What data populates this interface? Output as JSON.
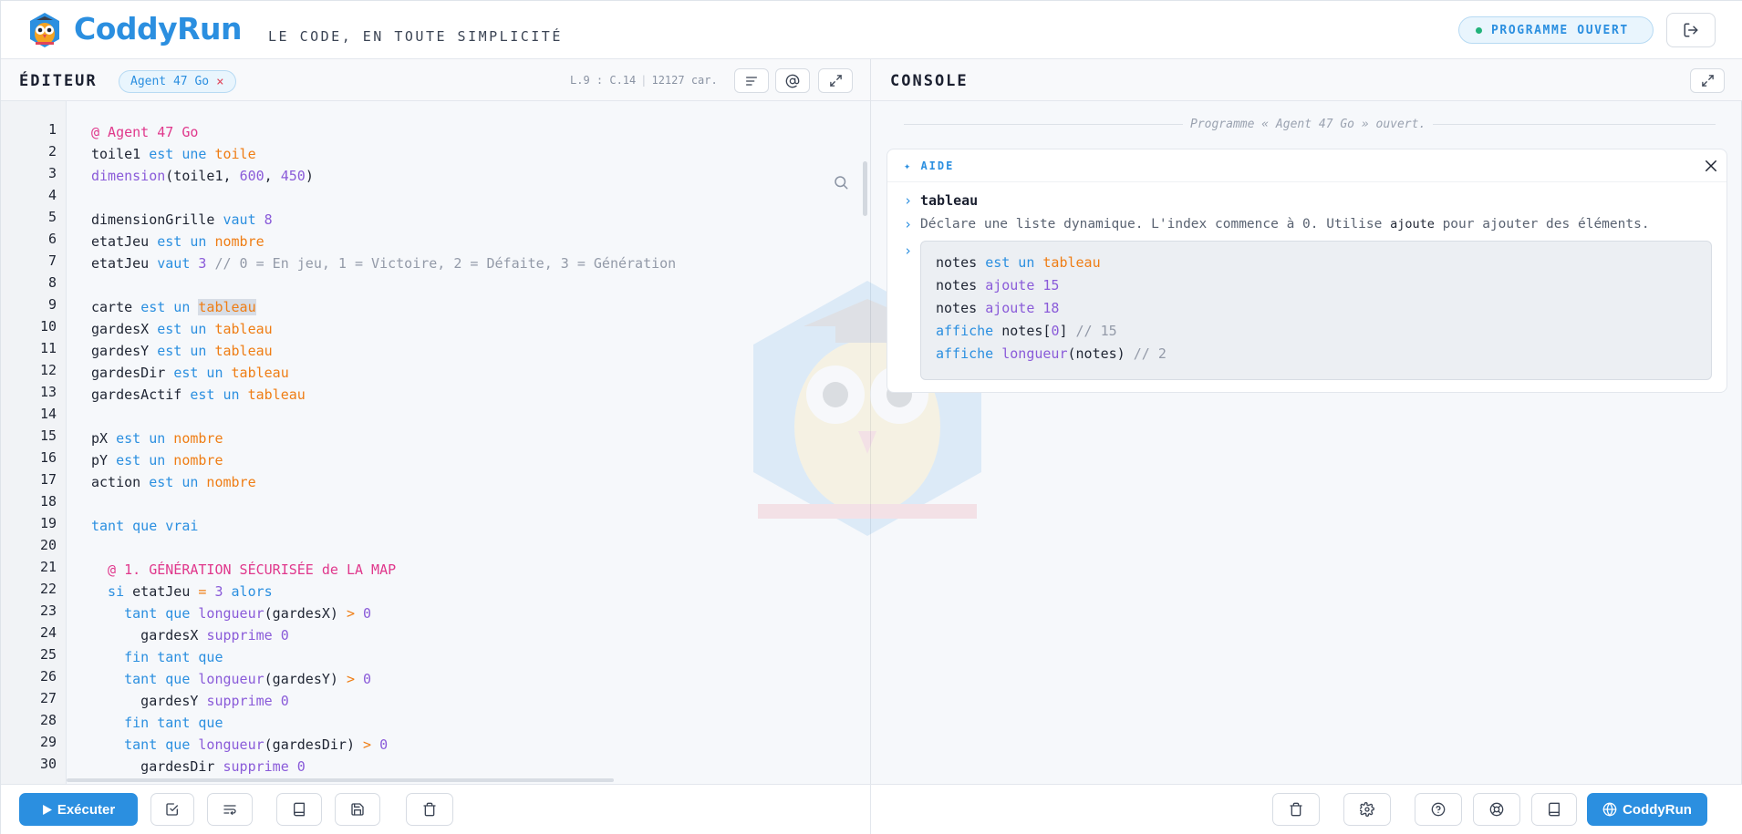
{
  "header": {
    "brand": "CoddyRun",
    "tagline": "LE CODE, EN TOUTE SIMPLICITÉ",
    "status": "PROGRAMME OUVERT"
  },
  "editor": {
    "title": "ÉDITEUR",
    "tab_label": "Agent 47 Go",
    "tab_close": "×",
    "cursor": "L.9 : C.14",
    "chars": "12127 car.",
    "line_numbers": [
      "1",
      "2",
      "3",
      "4",
      "5",
      "6",
      "7",
      "8",
      "9",
      "10",
      "11",
      "12",
      "13",
      "14",
      "15",
      "16",
      "17",
      "18",
      "19",
      "20",
      "21",
      "22",
      "23",
      "24",
      "25",
      "26",
      "27",
      "28",
      "29",
      "30"
    ],
    "code": {
      "l1": "@ Agent 47 Go",
      "l2_a": "toile1",
      "l2_b": " est une ",
      "l2_c": "toile",
      "l3_a": "dimension",
      "l3_b": "(toile1, ",
      "l3_c": "600",
      "l3_d": ", ",
      "l3_e": "450",
      "l3_f": ")",
      "l5_a": "dimensionGrille ",
      "l5_b": "vaut",
      "l5_c": " 8",
      "l6_a": "etatJeu ",
      "l6_b": "est un",
      "l6_c": " nombre",
      "l7_a": "etatJeu ",
      "l7_b": "vaut",
      "l7_c": " 3",
      "l7_d": " // 0 = En jeu, 1 = Victoire, 2 = Défaite, 3 = Génération",
      "l9_a": "carte ",
      "l9_b": "est un",
      "l9_c": " ",
      "l9_d": "tableau",
      "l10_a": "gardesX ",
      "l10_b": "est un",
      "l10_c": " tableau",
      "l11_a": "gardesY ",
      "l11_b": "est un",
      "l11_c": " tableau",
      "l12_a": "gardesDir ",
      "l12_b": "est un",
      "l12_c": " tableau",
      "l13_a": "gardesActif ",
      "l13_b": "est un",
      "l13_c": " tableau",
      "l15_a": "pX ",
      "l15_b": "est un",
      "l15_c": " nombre",
      "l16_a": "pY ",
      "l16_b": "est un",
      "l16_c": " nombre",
      "l17_a": "action ",
      "l17_b": "est un",
      "l17_c": " nombre",
      "l19": "tant que vrai",
      "l21": "  @ 1. GÉNÉRATION SÉCURISÉE de LA MAP",
      "l22_a": "  si",
      "l22_b": " etatJeu ",
      "l22_c": "=",
      "l22_d": " 3",
      "l22_e": " alors",
      "l23_a": "    tant que ",
      "l23_b": "longueur",
      "l23_c": "(gardesX) ",
      "l23_d": ">",
      "l23_e": " 0",
      "l24_a": "      gardesX ",
      "l24_b": "supprime",
      "l24_c": " 0",
      "l25": "    fin tant que",
      "l26_a": "    tant que ",
      "l26_b": "longueur",
      "l26_c": "(gardesY) ",
      "l26_d": ">",
      "l26_e": " 0",
      "l27_a": "      gardesY ",
      "l27_b": "supprime",
      "l27_c": " 0",
      "l28": "    fin tant que",
      "l29_a": "    tant que ",
      "l29_b": "longueur",
      "l29_c": "(gardesDir) ",
      "l29_d": ">",
      "l29_e": " 0",
      "l30_a": "      gardesDir ",
      "l30_b": "supprime",
      "l30_c": " 0"
    }
  },
  "console": {
    "title": "CONSOLE",
    "message": "Programme « Agent 47 Go » ouvert.",
    "help": {
      "title": "✦ AIDE",
      "chevron": "›",
      "word": "tableau",
      "desc_a": "Déclare une liste dynamique. L'index commence à 0. Utilise ",
      "desc_code": "ajoute",
      "desc_b": " pour ajouter des éléments.",
      "example": {
        "e1_a": "notes ",
        "e1_b": "est un",
        "e1_c": " tableau",
        "e2_a": "notes ",
        "e2_b": "ajoute",
        "e2_c": " 15",
        "e3_a": "notes ",
        "e3_b": "ajoute",
        "e3_c": " 18",
        "e4_a": "affiche",
        "e4_b": " notes[",
        "e4_c": "0",
        "e4_d": "]",
        "e4_e": " // 15",
        "e5_a": "affiche",
        "e5_b": " ",
        "e5_c": "longueur",
        "e5_d": "(notes)",
        "e5_e": " // 2"
      }
    }
  },
  "toolbar": {
    "run_label": "Exécuter",
    "brand_button": "CoddyRun"
  },
  "colors": {
    "accent": "#2b8fe0",
    "keyword": "#2b8fe0",
    "type": "#ef7d14",
    "function": "#8a5bd9",
    "comment": "#939aa8",
    "annotation": "#e0388c",
    "status_dot": "#21b37a"
  },
  "icons": {
    "logo": "owl-logo-icon",
    "logout": "logout-icon",
    "format": "format-lines-icon",
    "mention": "at-icon",
    "expand": "expand-icon",
    "search": "search-icon",
    "run": "play-icon",
    "check": "check-square-icon",
    "wrap": "wrap-icon",
    "book": "book-icon",
    "save": "save-icon",
    "trash": "trash-icon",
    "settings": "gear-icon",
    "help": "help-circle-icon",
    "support": "lifebuoy-icon",
    "globe": "globe-icon"
  }
}
